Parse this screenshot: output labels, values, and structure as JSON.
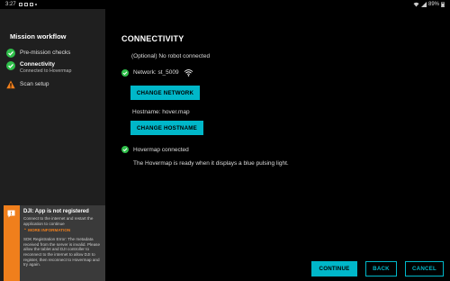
{
  "statusbar": {
    "time": "3:27",
    "battery": "89%"
  },
  "sidebar": {
    "title": "Mission workflow",
    "steps": [
      {
        "label": "Pre-mission checks",
        "status": "done"
      },
      {
        "label": "Connectivity",
        "sub": "Connected to Hovermap",
        "status": "done"
      },
      {
        "label": "Scan setup",
        "status": "warning"
      }
    ]
  },
  "notice": {
    "title": "DJI: App is not registered",
    "text1": "Connect to the internet and restart the application to continue",
    "more": "⌃ MORE INFORMATION",
    "text2": "SDK Registration Error: The metadata received from the server is invalid. Please allow the tablet and DJI controller to reconnect to the internet to allow DJI to register, then reconnect to Hovermap and try again."
  },
  "main": {
    "title": "CONNECTIVITY",
    "robot_status": "(Optional) No robot connected",
    "network_label": "Network: st_5009",
    "change_network": "CHANGE NETWORK",
    "hostname_label": "Hostname: hover.map",
    "change_hostname": "CHANGE HOSTNAME",
    "hovermap_status": "Hovermap connected",
    "ready_text": "The Hovermap is ready when it displays a blue pulsing light."
  },
  "footer": {
    "continue": "CONTINUE",
    "back": "BACK",
    "cancel": "CANCEL"
  },
  "colors": {
    "accent": "#00b7c9",
    "success": "#2fbf4a",
    "warning": "#f07f1c",
    "sidebar": "#1f1f1f"
  }
}
